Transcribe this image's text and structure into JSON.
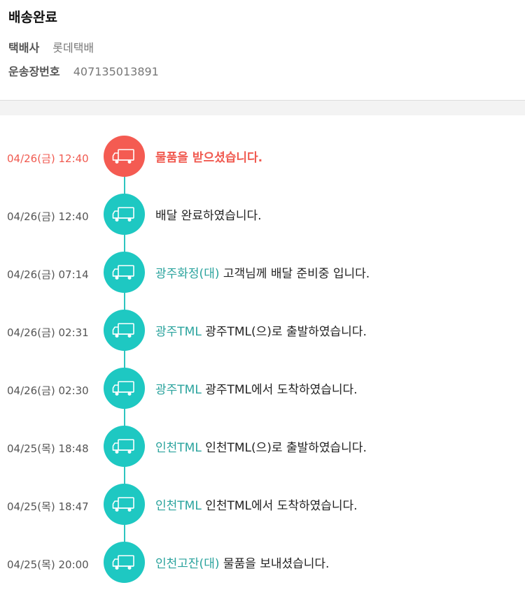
{
  "header": {
    "status": "배송완료",
    "courier_label": "택배사",
    "courier_value": "롯데택배",
    "tracking_label": "운송장번호",
    "tracking_value": "407135013891"
  },
  "colors": {
    "active": "#f45b52",
    "normal": "#1ec8c2",
    "location_text": "#2aa39d",
    "line": "#2ec5c0"
  },
  "icon": "truck-icon",
  "events": [
    {
      "time": "04/26(금) 12:40",
      "location": "",
      "message": "물품을 받으셨습니다.",
      "active": true
    },
    {
      "time": "04/26(금) 12:40",
      "location": "",
      "message": "배달 완료하였습니다.",
      "active": false
    },
    {
      "time": "04/26(금) 07:14",
      "location": "광주화정(대)",
      "message": " 고객님께 배달 준비중 입니다.",
      "active": false
    },
    {
      "time": "04/26(금) 02:31",
      "location": "광주TML",
      "message": " 광주TML(으)로 출발하였습니다.",
      "active": false
    },
    {
      "time": "04/26(금) 02:30",
      "location": "광주TML",
      "message": " 광주TML에서 도착하였습니다.",
      "active": false
    },
    {
      "time": "04/25(목) 18:48",
      "location": "인천TML",
      "message": " 인천TML(으)로 출발하였습니다.",
      "active": false
    },
    {
      "time": "04/25(목) 18:47",
      "location": "인천TML",
      "message": " 인천TML에서 도착하였습니다.",
      "active": false
    },
    {
      "time": "04/25(목) 20:00",
      "location": "인천고잔(대)",
      "message": " 물품을 보내셨습니다.",
      "active": false
    }
  ]
}
